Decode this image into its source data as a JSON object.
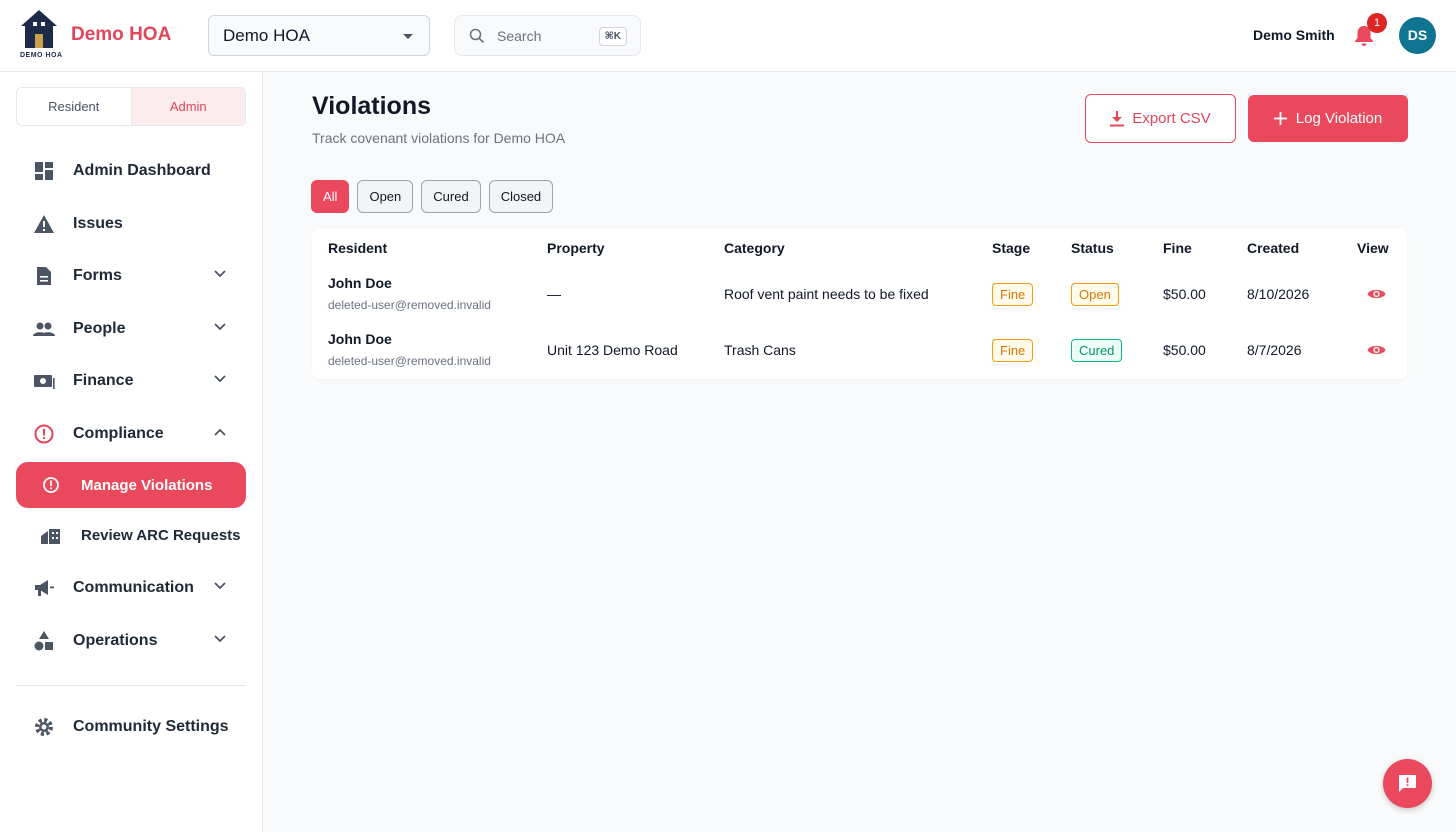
{
  "header": {
    "logo_text": "DEMO HOA",
    "brand": "Demo HOA",
    "org_select_value": "Demo HOA",
    "search_placeholder": "Search",
    "search_shortcut": "⌘K",
    "user_name": "Demo Smith",
    "notification_count": "1",
    "avatar_initials": "DS"
  },
  "sidebar": {
    "role_tabs": [
      "Resident",
      "Admin"
    ],
    "active_role": "Admin",
    "items": [
      {
        "label": "Admin Dashboard",
        "icon": "dashboard-icon"
      },
      {
        "label": "Issues",
        "icon": "warning-icon"
      },
      {
        "label": "Forms",
        "icon": "document-icon",
        "expandable": true
      },
      {
        "label": "People",
        "icon": "people-icon",
        "expandable": true
      },
      {
        "label": "Finance",
        "icon": "money-icon",
        "expandable": true
      },
      {
        "label": "Compliance",
        "icon": "alert-circle-icon",
        "expanded": true
      },
      {
        "label": "Manage Violations",
        "icon": "alert-circle-icon",
        "active": true
      },
      {
        "label": "Review ARC Requests",
        "icon": "buildings-icon"
      },
      {
        "label": "Communication",
        "icon": "megaphone-icon",
        "expandable": true
      },
      {
        "label": "Operations",
        "icon": "shapes-icon",
        "expandable": true
      },
      {
        "label": "Community Settings",
        "icon": "gear-icon"
      }
    ]
  },
  "main": {
    "title": "Violations",
    "subtitle": "Track covenant violations for Demo HOA",
    "export_label": "Export CSV",
    "log_label": "Log Violation",
    "filters": [
      "All",
      "Open",
      "Cured",
      "Closed"
    ],
    "active_filter": "All",
    "table": {
      "columns": [
        "Resident",
        "Property",
        "Category",
        "Stage",
        "Status",
        "Fine",
        "Created",
        "View"
      ],
      "rows": [
        {
          "resident": "John Doe",
          "email": "deleted-user@removed.invalid",
          "property": "—",
          "category": "Roof vent paint needs to be fixed",
          "stage": "Fine",
          "status": "Open",
          "fine": "$50.00",
          "created": "8/10/2026"
        },
        {
          "resident": "John Doe",
          "email": "deleted-user@removed.invalid",
          "property": "Unit 123 Demo Road",
          "category": "Trash Cans",
          "stage": "Fine",
          "status": "Cured",
          "fine": "$50.00",
          "created": "8/7/2026"
        }
      ]
    }
  },
  "colors": {
    "accent": "#e9485d",
    "warning": "#d97706",
    "success": "#059669",
    "avatar": "#0e7490"
  }
}
